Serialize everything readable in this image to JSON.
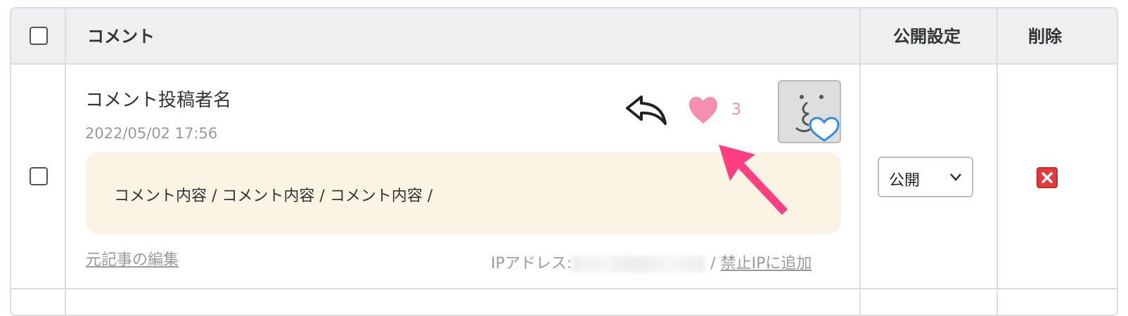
{
  "header": {
    "comment_label": "コメント",
    "visibility_label": "公開設定",
    "delete_label": "削除"
  },
  "row": {
    "author": "コメント投稿者名",
    "date": "2022/05/02 17:56",
    "content": "コメント内容 / コメント内容 / コメント内容 /",
    "like_count": "3",
    "edit_link": "元記事の編集",
    "ip_label": "IPアドレス:",
    "ip_separator": "/ ",
    "ban_link": "禁止IPに追加",
    "visibility_value": "公開",
    "icons": [
      "reply-icon",
      "heart-icon",
      "avatar-face-icon",
      "chevron-down-icon",
      "delete-icon"
    ]
  },
  "colors": {
    "heart": "#f58fb0",
    "bubble": "#fbf3e3",
    "delete": "#e23b3b",
    "arrow": "#ff3f7f"
  }
}
